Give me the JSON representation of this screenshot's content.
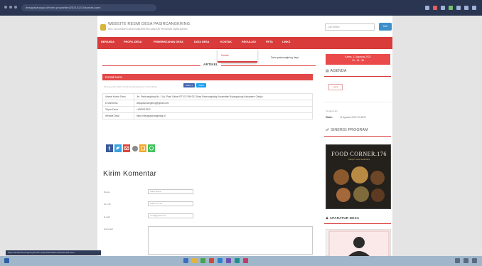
{
  "browser": {
    "url": "desapakanpujo.id/index.php/artikel/2021/12/24/kontak-kami"
  },
  "header": {
    "title": "WEBSITE RESMI DESA PASIRCANGKRING",
    "subtitle": "KEC. BOJONGPICUNG KABUPATEN CIANJUR PROVINSI JAWA BARAT",
    "search_placeholder": "Cari Artikel",
    "search_button": "Cari"
  },
  "nav": {
    "items": [
      "BERANDA",
      "PROFIL DESA",
      "PEMERINTAHAN DESA",
      "DATA DESA",
      "KONTAK",
      "REGULASI",
      "PETA",
      "LINKS"
    ]
  },
  "dropdown": {
    "item": "Kontak",
    "right_text": "Desa pasircangkring Jaya"
  },
  "date_box": {
    "line1": "Kamis, 11 Agustus 2022",
    "line2": "19 : 45 : 38"
  },
  "article": {
    "section_label": "ARTIKEL",
    "title": "Kontak Kami",
    "meta": "24 Desember 2021 13:23:12  Administrator  1.212 Dibaca",
    "share_fb": "Share 1",
    "share_tw": "Tweet",
    "rows": [
      {
        "key": "Alamat Kantor Desa",
        "value": "Jln. Pasircangkring No. 1 Kp. Pasir Dalam RT 012 RW 001 Desa Pasircangkring Kecamatan Bojongpicung Kabupaten Cianjur"
      },
      {
        "key": "E-Mail Desa",
        "value": "desapasircangkring@gmail.com"
      },
      {
        "key": "Telpon Desa",
        "value": "+6283917822"
      },
      {
        "key": "Website Desa",
        "value": "https://desapasircangkring.id"
      }
    ]
  },
  "comment_form": {
    "title": "Kirim Komentar",
    "fields": [
      {
        "label": "Nama",
        "placeholder": "Isikan Nama"
      },
      {
        "label": "No. HP",
        "placeholder": "Isikan No. HP"
      },
      {
        "label": "E-mail",
        "placeholder": "email@gmail.com"
      },
      {
        "label": "Komentar",
        "placeholder": ""
      }
    ]
  },
  "sidebar": {
    "agenda_title": "AGENDA",
    "agenda_tab": "Lama",
    "agenda_date_label": "Tanggal Hari",
    "agenda_waktu_label": "Waktu",
    "agenda_time": "11 Agustus 2022 19:45:00",
    "sinergi_title": "SINERGI PROGRAM",
    "food_title": "FOOD CORNER.176",
    "food_subtitle": "Cianjur rasa nusantara",
    "aparatur_title": "APARATUR DESA"
  },
  "statusbar": {
    "text": "https://desapasircangkring.id/index.php/artikel/2021/12/24/kontak-kami"
  },
  "colors": {
    "nav_red": "#d93a3a",
    "accent_blue": "#3d8fc9",
    "taskbar": "#9fb7c9"
  }
}
